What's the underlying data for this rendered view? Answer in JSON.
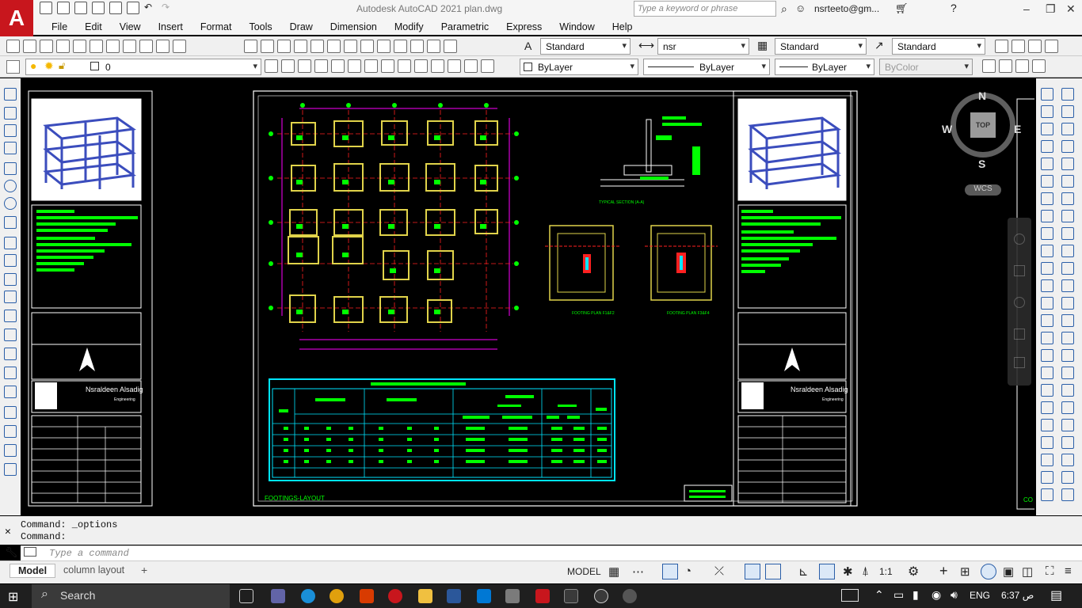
{
  "app": {
    "logo": "A",
    "title": "Autodesk AutoCAD 2021   plan.dwg",
    "search_placeholder": "Type a keyword or phrase",
    "user": "nsrteeto@gm..."
  },
  "menu": [
    "File",
    "Edit",
    "View",
    "Insert",
    "Format",
    "Tools",
    "Draw",
    "Dimension",
    "Modify",
    "Parametric",
    "Express",
    "Window",
    "Help"
  ],
  "toolbar1": {
    "text_style": "Standard",
    "dim_style": "nsr",
    "table_style": "Standard",
    "multileader_style": "Standard"
  },
  "toolbar2": {
    "layer": "0",
    "color": "ByLayer",
    "linetype": "ByLayer",
    "lineweight": "ByLayer",
    "plot_style": "ByColor"
  },
  "viewcube": {
    "north": "N",
    "south": "S",
    "east": "E",
    "west": "W",
    "face": "TOP",
    "ucs": "WCS"
  },
  "drawing": {
    "layout_label": "FOOTINGS-LAYOUT",
    "section_label": "TYPICAL SECTION (A-A)",
    "footing_label_1": "FOOTING PLAN F1&F2",
    "footing_label_2": "FOOTING PLAN F3&F4",
    "designer_name": "Nsraldeen Alsadig",
    "designer_role": "Engineering",
    "edge_label": "CO"
  },
  "command": {
    "history": [
      "Command: _options",
      "Command:"
    ],
    "placeholder": "Type a command"
  },
  "layout_tabs": [
    "Model",
    "column layout"
  ],
  "status": {
    "mode": "MODEL",
    "scale": "1:1"
  },
  "taskbar": {
    "search": "Search",
    "language": "ENG",
    "time": "6:37 ص"
  },
  "colors": {
    "autocad_red": "#c8161d",
    "drawing_bg": "#000000",
    "cad_green": "#00ff00",
    "cad_yellow": "#e0d34a",
    "cad_magenta": "#ff00ff",
    "cad_cyan": "#00e5ff",
    "cad_red": "#ff2020"
  }
}
